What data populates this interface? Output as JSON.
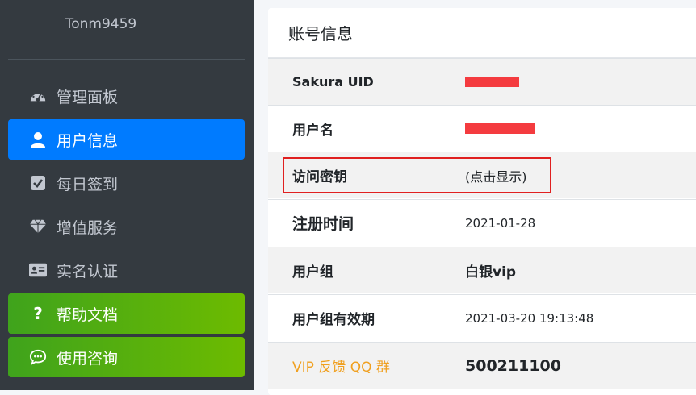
{
  "sidebar": {
    "username": "Tonm9459",
    "items": [
      {
        "label": "管理面板",
        "icon": "dashboard-icon"
      },
      {
        "label": "用户信息",
        "icon": "user-icon"
      },
      {
        "label": "每日签到",
        "icon": "checkbox-icon"
      },
      {
        "label": "增值服务",
        "icon": "diamond-icon"
      },
      {
        "label": "实名认证",
        "icon": "id-card-icon"
      },
      {
        "label": "帮助文档",
        "icon": "question-icon"
      },
      {
        "label": "使用咨询",
        "icon": "chat-icon"
      }
    ],
    "active_color": "#007bff",
    "help_color": "#5cb21a"
  },
  "account": {
    "title": "账号信息",
    "rows": [
      {
        "label": "Sakura UID",
        "value": ""
      },
      {
        "label": "用户名",
        "value": ""
      },
      {
        "label": "访问密钥",
        "value": "(点击显示)"
      },
      {
        "label": "注册时间",
        "value": "2021-01-28"
      },
      {
        "label": "用户组",
        "value": "白银vip"
      },
      {
        "label": "用户组有效期",
        "value": "2021-03-20 19:13:48"
      },
      {
        "label": "VIP 反馈 QQ 群",
        "value": "500211100"
      }
    ]
  }
}
